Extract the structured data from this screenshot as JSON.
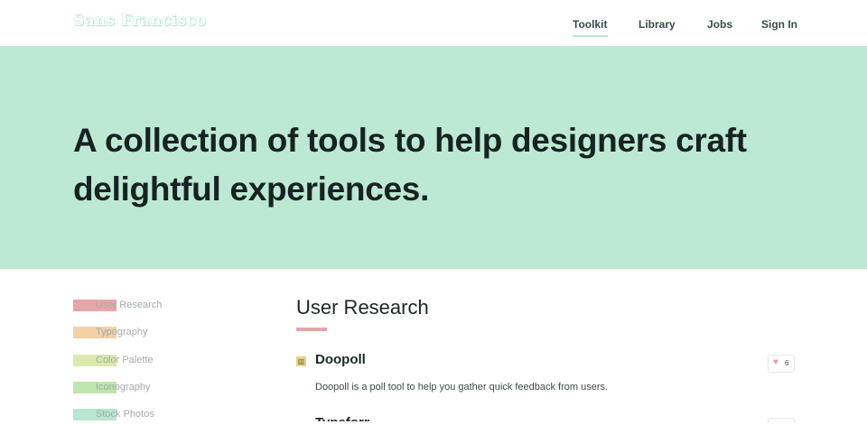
{
  "header": {
    "logo": "Sans Francisco",
    "nav": [
      {
        "label": "Toolkit",
        "active": true
      },
      {
        "label": "Library",
        "active": false
      },
      {
        "label": "Jobs",
        "active": false
      },
      {
        "label": "Sign In",
        "active": false
      }
    ]
  },
  "hero": {
    "title": "A collection of tools to help designers craft delightful experiences.",
    "background": "#bde9d4"
  },
  "sidebar": {
    "items": [
      {
        "label": "User Research",
        "color": "#e8a5a9"
      },
      {
        "label": "Typography",
        "color": "#f4d0a6"
      },
      {
        "label": "Color Palette",
        "color": "#dbe9ae"
      },
      {
        "label": "Iconography",
        "color": "#bfe6ad"
      },
      {
        "label": "Stock Photos",
        "color": "#b8e6d0"
      }
    ]
  },
  "main": {
    "section_title": "User Research",
    "section_color": "#e3a6a9",
    "tools": [
      {
        "name": "Doopoll",
        "description": "Doopoll is a poll tool to help you gather quick feedback from users.",
        "likes": "6",
        "icon": "poll-icon"
      }
    ],
    "next_tool_peek": "Typeform"
  }
}
